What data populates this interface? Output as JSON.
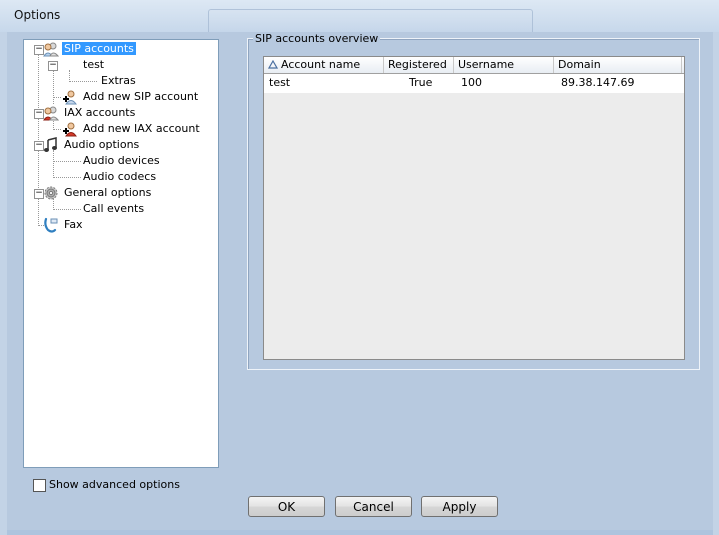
{
  "window": {
    "title": "Options"
  },
  "tree": {
    "items": [
      {
        "label": "SIP accounts",
        "selected": true,
        "icon": "sip-users-icon"
      },
      {
        "label": "test"
      },
      {
        "label": "Extras"
      },
      {
        "label": "Add new SIP account",
        "icon": "add-user-icon"
      },
      {
        "label": "IAX accounts",
        "icon": "iax-users-icon"
      },
      {
        "label": "Add new IAX account",
        "icon": "add-user-icon"
      },
      {
        "label": "Audio options",
        "icon": "music-note-icon"
      },
      {
        "label": "Audio devices"
      },
      {
        "label": "Audio codecs"
      },
      {
        "label": "General options",
        "icon": "gear-icon"
      },
      {
        "label": "Call events"
      },
      {
        "label": "Fax",
        "icon": "fax-icon"
      }
    ]
  },
  "overview": {
    "title": "SIP accounts overview",
    "columns": [
      "Account name",
      "Registered",
      "Username",
      "Domain"
    ],
    "rows": [
      {
        "account": "test",
        "registered": "True",
        "username": "100",
        "domain": "89.38.147.69"
      }
    ]
  },
  "options": {
    "show_advanced_label": "Show advanced options",
    "show_advanced_checked": false
  },
  "buttons": {
    "ok": "OK",
    "cancel": "Cancel",
    "apply": "Apply"
  },
  "colors": {
    "selection": "#3399ff",
    "window": "#b7c9df"
  }
}
